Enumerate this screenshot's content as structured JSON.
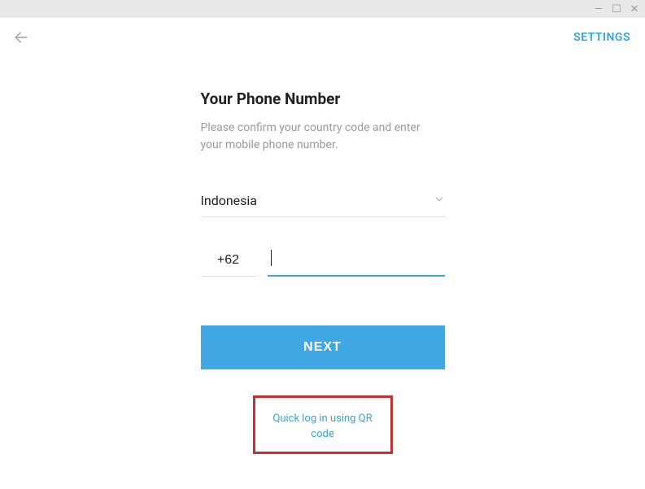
{
  "window": {
    "minimize": "—",
    "maximize": "☐",
    "close": "✕"
  },
  "header": {
    "settings_label": "SETTINGS"
  },
  "main": {
    "title": "Your Phone Number",
    "subtitle": "Please confirm your country code and enter your mobile phone number.",
    "country": "Indonesia",
    "country_code": "+62",
    "phone_value": "",
    "next_label": "NEXT",
    "qr_label": "Quick log in using QR code"
  }
}
